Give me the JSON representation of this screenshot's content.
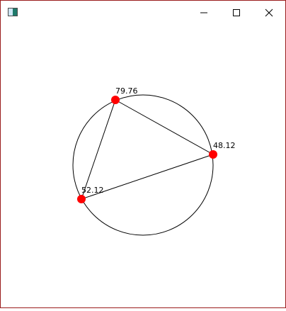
{
  "window": {
    "title": "",
    "buttons": {
      "minimize_icon": "minimize-icon",
      "maximize_icon": "maximize-icon",
      "close_icon": "close-icon"
    }
  },
  "diagram": {
    "colors": {
      "circle_stroke": "#000000",
      "triangle_stroke": "#000000",
      "vertex_fill": "#ff0000"
    },
    "vertices": [
      {
        "label": "79.76"
      },
      {
        "label": "48.12"
      },
      {
        "label": "52.12"
      }
    ]
  }
}
